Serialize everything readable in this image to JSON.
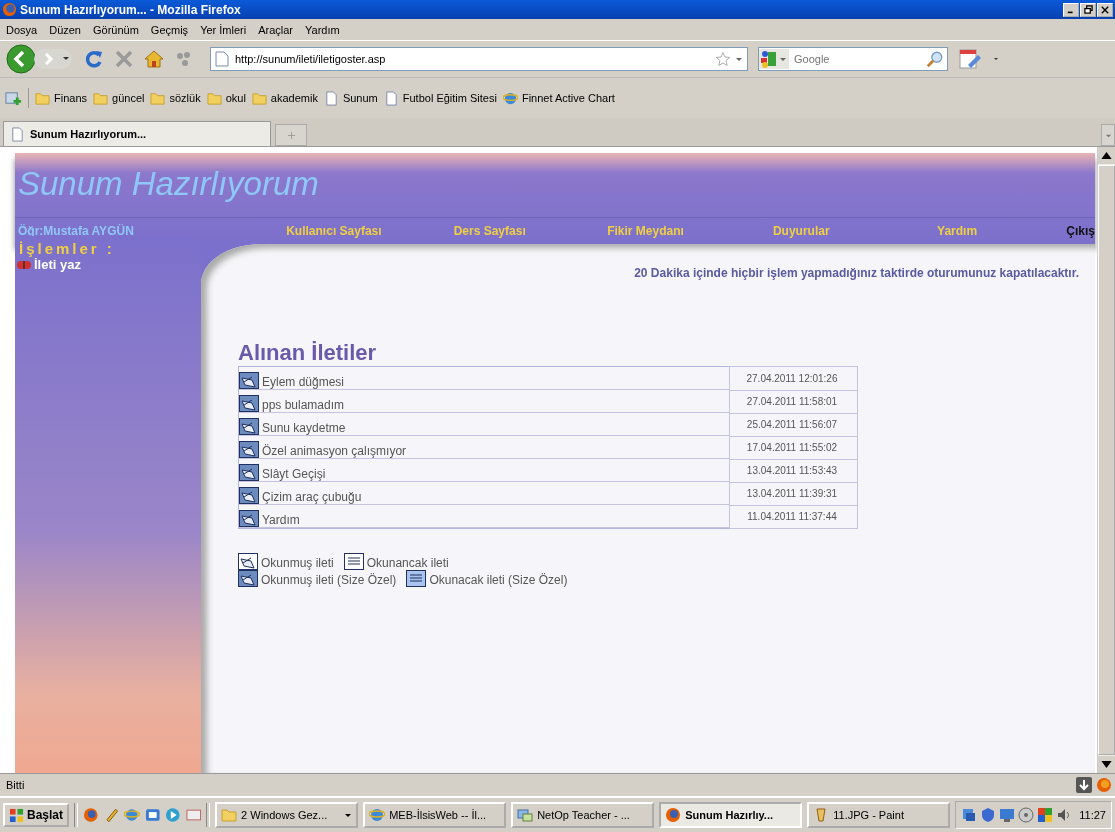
{
  "window": {
    "title": "Sunum Hazırlıyorum... - Mozilla Firefox"
  },
  "menu": [
    "Dosya",
    "Düzen",
    "Görünüm",
    "Geçmiş",
    "Yer İmleri",
    "Araçlar",
    "Yardım"
  ],
  "address": {
    "value": "http://sunum/ileti/iletigoster.asp"
  },
  "search": {
    "placeholder": "Google"
  },
  "bookmarks": [
    {
      "kind": "folder",
      "label": "Finans"
    },
    {
      "kind": "folder",
      "label": "güncel"
    },
    {
      "kind": "folder",
      "label": "sözlük"
    },
    {
      "kind": "folder",
      "label": "okul"
    },
    {
      "kind": "folder",
      "label": "akademik"
    },
    {
      "kind": "page",
      "label": "Sunum"
    },
    {
      "kind": "page",
      "label": "Futbol Eğitim Sitesi"
    },
    {
      "kind": "ie",
      "label": "Finnet Active Chart"
    }
  ],
  "tabs": [
    {
      "label": "Sunum Hazırlıyorum...",
      "selected": true
    }
  ],
  "page": {
    "site_title": "Sunum Hazırlıyorum",
    "user": "Öğr:Mustafa AYGÜN",
    "nav": [
      {
        "label": "Kullanıcı Sayfası",
        "kind": "link"
      },
      {
        "label": "Ders Sayfası",
        "kind": "link"
      },
      {
        "label": "Fikir Meydanı",
        "kind": "link"
      },
      {
        "label": "Duyurular",
        "kind": "link"
      },
      {
        "label": "Yardım",
        "kind": "link"
      },
      {
        "label": "Çıkış",
        "kind": "exit"
      }
    ],
    "sidebar": {
      "heading": "İşlemler :",
      "items": [
        "İleti yaz"
      ]
    },
    "notice": "20 Dakika içinde hiçbir işlem yapmadığınız taktirde oturumunuz kapatılacaktır.",
    "heading": "Alınan İletiler",
    "messages": [
      {
        "subject": "Eylem düğmesi",
        "date": "27.04.2011 12:01:26",
        "read": true
      },
      {
        "subject": "pps bulamadım",
        "date": "27.04.2011 11:58:01",
        "read": true
      },
      {
        "subject": "Sunu kaydetme",
        "date": "25.04.2011 11:56:07",
        "read": true
      },
      {
        "subject": "Özel animasyon çalışmıyor",
        "date": "17.04.2011 11:55:02",
        "read": true
      },
      {
        "subject": "Slâyt Geçişi",
        "date": "13.04.2011 11:53:43",
        "read": true
      },
      {
        "subject": "Çizim araç çubuğu",
        "date": "13.04.2011 11:39:31",
        "read": true
      },
      {
        "subject": "Yardım",
        "date": "11.04.2011 11:37:44",
        "read": true
      }
    ],
    "legend": [
      [
        {
          "label": "Okunmuş ileti",
          "read": true,
          "private": false
        },
        {
          "label": "Okunancak ileti",
          "read": false,
          "private": false
        }
      ],
      [
        {
          "label": "Okunmuş ileti (Size Özel)",
          "read": true,
          "private": true
        },
        {
          "label": "Okunacak ileti (Size Özel)",
          "read": false,
          "private": true
        }
      ]
    ]
  },
  "status_bar": {
    "text": "Bitti"
  },
  "taskbar": {
    "start": "Başlat",
    "tasks": [
      {
        "label": "2 Windows Gez...",
        "selected": false,
        "kind": "folder"
      },
      {
        "label": "MEB-İlsisWeb -- İl...",
        "selected": false,
        "kind": "ie"
      },
      {
        "label": "NetOp Teacher - ...",
        "selected": false,
        "kind": "app"
      },
      {
        "label": "Sunum Hazırlıy...",
        "selected": true,
        "kind": "firefox"
      },
      {
        "label": "11.JPG - Paint",
        "selected": false,
        "kind": "paint"
      }
    ],
    "clock": "11:27"
  }
}
